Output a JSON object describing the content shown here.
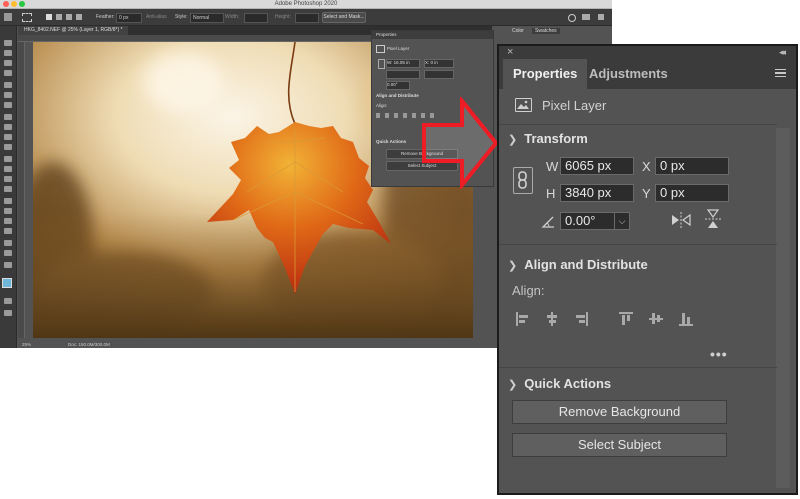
{
  "app": {
    "title": "Adobe Photoshop 2020",
    "document_tab": "HKG_8402.NEF @ 25% (Layer 1, RGB/8*) *",
    "status_zoom": "25%",
    "status_doc": "Doc: 150.0M/300.0M"
  },
  "options_bar": {
    "feather_label": "Feather:",
    "feather_value": "0 px",
    "antialias_label": "Anti-alias",
    "style_label": "Style:",
    "style_value": "Normal",
    "width_label": "Width:",
    "height_label": "Height:",
    "select_mask_button": "Select and Mask..."
  },
  "side_tabs": {
    "color": "Color",
    "swatches": "Swatches"
  },
  "mini_panel": {
    "title": "Properties",
    "layer": "Pixel Layer",
    "w": "W: 16.05 in",
    "x": "X: 0 in",
    "angle": "0.00°",
    "align_title": "Align and Distribute",
    "align_label": "Align:",
    "quick_title": "Quick Actions",
    "remove_bg": "Remove Background",
    "select_subject": "Select Subject"
  },
  "panel": {
    "tabs": [
      "Properties",
      "Adjustments"
    ],
    "layer_type": "Pixel Layer",
    "transform": {
      "title": "Transform",
      "w_label": "W",
      "w_value": "6065 px",
      "h_label": "H",
      "h_value": "3840 px",
      "x_label": "X",
      "x_value": "0 px",
      "y_label": "Y",
      "y_value": "0 px",
      "angle_value": "0.00°"
    },
    "align": {
      "title": "Align and Distribute",
      "label": "Align:",
      "more": "•••"
    },
    "quick_actions": {
      "title": "Quick Actions",
      "remove_background": "Remove Background",
      "select_subject": "Select Subject"
    }
  },
  "colors": {
    "panel_bg": "#535353",
    "arrow_red": "#ee1c24"
  }
}
